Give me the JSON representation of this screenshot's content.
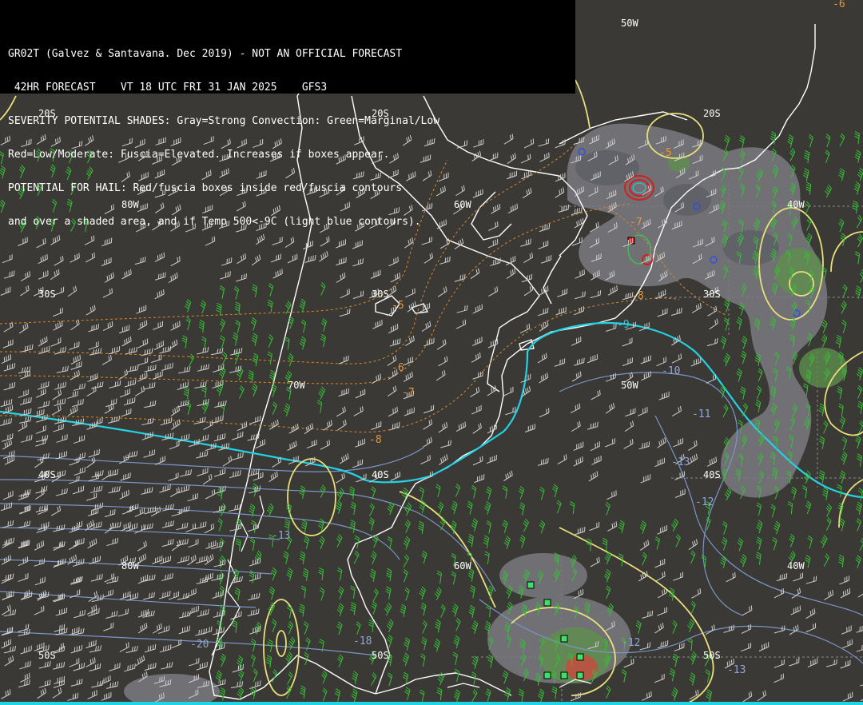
{
  "header": {
    "lines": [
      "GR02T (Galvez & Santavana. Dec 2019) - NOT AN OFFICIAL FORECAST",
      " 42HR FORECAST    VT 18 UTC FRI 31 JAN 2025    GFS3",
      "SEVERITY POTENTIAL SHADES: Gray=Strong Convection: Green=Marginal/Low",
      "Red=Low/Moderate: Fuscia=Elevated. Increases if boxes appear.",
      "POTENTIAL FOR HAIL: Red/fuscia boxes inside red/fuscia contours",
      "and over a shaded area, and if Temp 500<-9C (light blue contours)."
    ]
  },
  "grid_labels": {
    "lat_20s_a": "20S",
    "lat_20s_b": "20S",
    "lat_20s_c": "20S",
    "lon_80w_a": "80W",
    "lon_60w_a": "60W",
    "lon_40w_a": "40W",
    "lon_50w_a": "50W",
    "lat_30s_a": "30S",
    "lat_30s_b": "30S",
    "lat_30s_c": "30S",
    "lon_70w_a": "70W",
    "lon_50w_b": "50W",
    "lat_40s_a": "40S",
    "lat_40s_b": "40S",
    "lat_40s_c": "40S",
    "lon_80w_b": "80W",
    "lon_60w_b": "60W",
    "lon_40w_b": "40W",
    "lat_50s_a": "50S",
    "lat_50s_b": "50S",
    "lat_50s_c": "50S"
  },
  "contour_labels": {
    "m5": "-5",
    "m6_top": "-6",
    "m6": "-6",
    "m7": "-7",
    "m7b": "-7",
    "m8": "-8",
    "m8b": "-8",
    "m9": "-9",
    "m10": "-10",
    "m11": "-11",
    "m12": "-12",
    "m13": "-13",
    "m13b": "-13",
    "m13c": "-13",
    "m18": "-18",
    "m20": "-20",
    "m12b": "-12"
  },
  "colors": {
    "background": "#3a3935",
    "coastline": "#ffffff",
    "temp_orange": "#d6892f",
    "temp_blue": "#7b95c9",
    "temp_9c_cyan": "#22d3e6",
    "severity_yellow": "#e8e07a",
    "wind_green": "#36c236",
    "wind_white": "#cfcfcf",
    "gray_shade": "#7a7a80",
    "green_shade": "#5e8f4e",
    "red_shade": "#c0503f",
    "hail_box_red": "#e02020",
    "hail_box_green": "#3ee06a"
  }
}
